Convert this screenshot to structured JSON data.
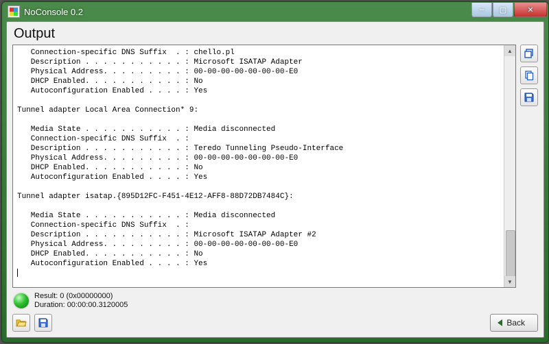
{
  "window": {
    "title": "NoConsole 0.2"
  },
  "heading": "Output",
  "console_text": "   Connection-specific DNS Suffix  . : chello.pl\n   Description . . . . . . . . . . . : Microsoft ISATAP Adapter\n   Physical Address. . . . . . . . . : 00-00-00-00-00-00-00-E0\n   DHCP Enabled. . . . . . . . . . . : No\n   Autoconfiguration Enabled . . . . : Yes\n\nTunnel adapter Local Area Connection* 9:\n\n   Media State . . . . . . . . . . . : Media disconnected\n   Connection-specific DNS Suffix  . :\n   Description . . . . . . . . . . . : Teredo Tunneling Pseudo-Interface\n   Physical Address. . . . . . . . . : 00-00-00-00-00-00-00-E0\n   DHCP Enabled. . . . . . . . . . . : No\n   Autoconfiguration Enabled . . . . : Yes\n\nTunnel adapter isatap.{895D12FC-F451-4E12-AFF8-88D72DB7484C}:\n\n   Media State . . . . . . . . . . . : Media disconnected\n   Connection-specific DNS Suffix  . :\n   Description . . . . . . . . . . . : Microsoft ISATAP Adapter #2\n   Physical Address. . . . . . . . . : 00-00-00-00-00-00-00-E0\n   DHCP Enabled. . . . . . . . . . . : No\n   Autoconfiguration Enabled . . . . : Yes\n",
  "status": {
    "result": "Result: 0 (0x00000000)",
    "duration": "Duration: 00:00:00.3120005",
    "led_color": "#30c030"
  },
  "buttons": {
    "back": "Back",
    "open": "Open",
    "save": "Save",
    "restore": "Restore",
    "copy": "Copy",
    "save_side": "Save"
  },
  "win_controls": {
    "min": "–",
    "max": "▢",
    "close": "✕"
  }
}
